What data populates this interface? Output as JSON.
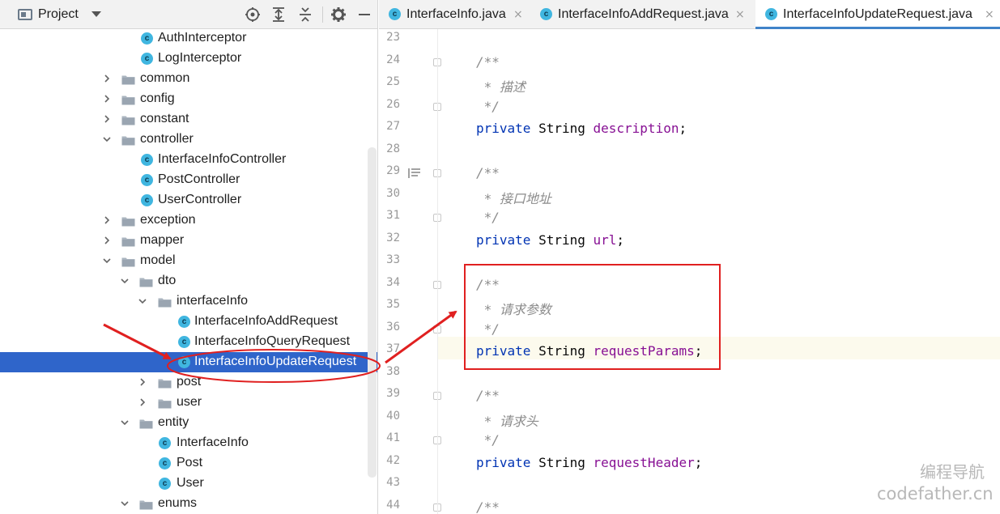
{
  "project_panel": {
    "title": "Project",
    "toolbar_icons": [
      "locate-icon",
      "expand-all-icon",
      "collapse-all-icon",
      "gear-icon",
      "minimize-icon"
    ],
    "tree": [
      {
        "label": "AuthInterceptor",
        "type": "class",
        "depth": 3,
        "expanded": null
      },
      {
        "label": "LogInterceptor",
        "type": "class",
        "depth": 3,
        "expanded": null
      },
      {
        "label": "common",
        "type": "folder",
        "depth": 2,
        "expanded": false
      },
      {
        "label": "config",
        "type": "folder",
        "depth": 2,
        "expanded": false
      },
      {
        "label": "constant",
        "type": "folder",
        "depth": 2,
        "expanded": false
      },
      {
        "label": "controller",
        "type": "folder",
        "depth": 2,
        "expanded": true
      },
      {
        "label": "InterfaceInfoController",
        "type": "class",
        "depth": 3,
        "expanded": null
      },
      {
        "label": "PostController",
        "type": "class",
        "depth": 3,
        "expanded": null
      },
      {
        "label": "UserController",
        "type": "class",
        "depth": 3,
        "expanded": null
      },
      {
        "label": "exception",
        "type": "folder",
        "depth": 2,
        "expanded": false
      },
      {
        "label": "mapper",
        "type": "folder",
        "depth": 2,
        "expanded": false
      },
      {
        "label": "model",
        "type": "folder",
        "depth": 2,
        "expanded": true
      },
      {
        "label": "dto",
        "type": "folder",
        "depth": 3,
        "expanded": true
      },
      {
        "label": "interfaceInfo",
        "type": "folder",
        "depth": 4,
        "expanded": true
      },
      {
        "label": "InterfaceInfoAddRequest",
        "type": "class",
        "depth": 5,
        "expanded": null
      },
      {
        "label": "InterfaceInfoQueryRequest",
        "type": "class",
        "depth": 5,
        "expanded": null
      },
      {
        "label": "InterfaceInfoUpdateRequest",
        "type": "class",
        "depth": 5,
        "expanded": null,
        "selected": true
      },
      {
        "label": "post",
        "type": "folder",
        "depth": 4,
        "expanded": false
      },
      {
        "label": "user",
        "type": "folder",
        "depth": 4,
        "expanded": false
      },
      {
        "label": "entity",
        "type": "folder",
        "depth": 3,
        "expanded": true
      },
      {
        "label": "InterfaceInfo",
        "type": "class",
        "depth": 4,
        "expanded": null
      },
      {
        "label": "Post",
        "type": "class",
        "depth": 4,
        "expanded": null
      },
      {
        "label": "User",
        "type": "class",
        "depth": 4,
        "expanded": null
      },
      {
        "label": "enums",
        "type": "folder",
        "depth": 3,
        "expanded": true
      }
    ]
  },
  "editor": {
    "tabs": [
      {
        "label": "InterfaceInfo.java",
        "close": "×",
        "active": false
      },
      {
        "label": "InterfaceInfoAddRequest.java",
        "close": "×",
        "active": false
      },
      {
        "label": "InterfaceInfoUpdateRequest.java",
        "close": "×",
        "active": true
      }
    ],
    "current_line": 37,
    "lines": [
      {
        "n": "23",
        "parts": []
      },
      {
        "n": "24",
        "parts": [
          {
            "c": "cmt",
            "t": "/**"
          }
        ]
      },
      {
        "n": "25",
        "parts": [
          {
            "c": "cmt",
            "t": " * 描述"
          }
        ]
      },
      {
        "n": "26",
        "parts": [
          {
            "c": "cmt",
            "t": " */"
          }
        ]
      },
      {
        "n": "27",
        "parts": [
          {
            "c": "kw",
            "t": "private "
          },
          {
            "c": "",
            "t": "String "
          },
          {
            "c": "fld",
            "t": "description"
          },
          {
            "c": "",
            "t": ";"
          }
        ]
      },
      {
        "n": "28",
        "parts": []
      },
      {
        "n": "29",
        "parts": [
          {
            "c": "cmt",
            "t": "/**"
          }
        ]
      },
      {
        "n": "30",
        "parts": [
          {
            "c": "cmt",
            "t": " * 接口地址"
          }
        ]
      },
      {
        "n": "31",
        "parts": [
          {
            "c": "cmt",
            "t": " */"
          }
        ]
      },
      {
        "n": "32",
        "parts": [
          {
            "c": "kw",
            "t": "private "
          },
          {
            "c": "",
            "t": "String "
          },
          {
            "c": "fld",
            "t": "url"
          },
          {
            "c": "",
            "t": ";"
          }
        ]
      },
      {
        "n": "33",
        "parts": []
      },
      {
        "n": "34",
        "parts": [
          {
            "c": "cmt",
            "t": "/**"
          }
        ]
      },
      {
        "n": "35",
        "parts": [
          {
            "c": "cmt",
            "t": " * 请求参数"
          }
        ]
      },
      {
        "n": "36",
        "parts": [
          {
            "c": "cmt",
            "t": " */"
          }
        ]
      },
      {
        "n": "37",
        "parts": [
          {
            "c": "kw",
            "t": "private "
          },
          {
            "c": "",
            "t": "String "
          },
          {
            "c": "fld",
            "t": "requestParams"
          },
          {
            "c": "",
            "t": ";"
          }
        ]
      },
      {
        "n": "38",
        "parts": []
      },
      {
        "n": "39",
        "parts": [
          {
            "c": "cmt",
            "t": "/**"
          }
        ]
      },
      {
        "n": "40",
        "parts": [
          {
            "c": "cmt",
            "t": " * 请求头"
          }
        ]
      },
      {
        "n": "41",
        "parts": [
          {
            "c": "cmt",
            "t": " */"
          }
        ]
      },
      {
        "n": "42",
        "parts": [
          {
            "c": "kw",
            "t": "private "
          },
          {
            "c": "",
            "t": "String "
          },
          {
            "c": "fld",
            "t": "requestHeader"
          },
          {
            "c": "",
            "t": ";"
          }
        ]
      },
      {
        "n": "43",
        "parts": []
      },
      {
        "n": "44",
        "parts": [
          {
            "c": "cmt",
            "t": "/**"
          }
        ]
      }
    ]
  },
  "watermark": {
    "line1": "编程导航",
    "line2": "codefather.cn"
  },
  "colors": {
    "selection": "#2f65ca",
    "annotation": "#e02020",
    "keyword": "#0033b3",
    "field": "#871094",
    "comment": "#8c8c8c"
  }
}
